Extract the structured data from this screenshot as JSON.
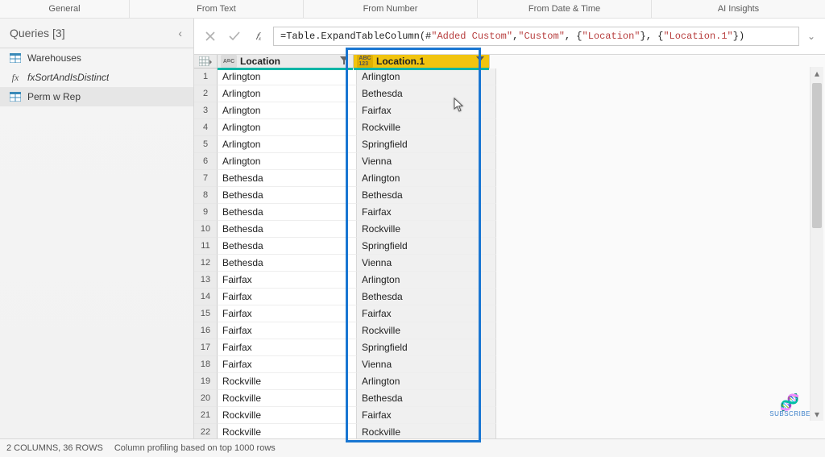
{
  "tabs": [
    "General",
    "From Text",
    "From Number",
    "From Date & Time",
    "AI Insights"
  ],
  "queries": {
    "title": "Queries",
    "count": "[3]",
    "items": [
      {
        "name": "Warehouses",
        "icon": "table"
      },
      {
        "name": "fxSortAndIsDistinct",
        "icon": "fx"
      },
      {
        "name": "Perm w Rep",
        "icon": "table",
        "selected": true
      }
    ]
  },
  "formula": {
    "prefix": "= ",
    "fn": "Table.ExpandTableColumn",
    "open": "(",
    "hash": "#",
    "arg1": "\"Added Custom\"",
    "c1": ", ",
    "arg2": "\"Custom\"",
    "c2": ", {",
    "arg3": "\"Location\"",
    "c3": "}, {",
    "arg4": "\"Location.1\"",
    "close": "})"
  },
  "columns": [
    {
      "name": "Location",
      "type": "ABC",
      "selected": false
    },
    {
      "name": "Location.1",
      "type": "ABC 123",
      "selected": true
    }
  ],
  "rows": [
    {
      "n": 1,
      "a": "Arlington",
      "b": "Arlington"
    },
    {
      "n": 2,
      "a": "Arlington",
      "b": "Bethesda"
    },
    {
      "n": 3,
      "a": "Arlington",
      "b": "Fairfax"
    },
    {
      "n": 4,
      "a": "Arlington",
      "b": "Rockville"
    },
    {
      "n": 5,
      "a": "Arlington",
      "b": "Springfield"
    },
    {
      "n": 6,
      "a": "Arlington",
      "b": "Vienna"
    },
    {
      "n": 7,
      "a": "Bethesda",
      "b": "Arlington"
    },
    {
      "n": 8,
      "a": "Bethesda",
      "b": "Bethesda"
    },
    {
      "n": 9,
      "a": "Bethesda",
      "b": "Fairfax"
    },
    {
      "n": 10,
      "a": "Bethesda",
      "b": "Rockville"
    },
    {
      "n": 11,
      "a": "Bethesda",
      "b": "Springfield"
    },
    {
      "n": 12,
      "a": "Bethesda",
      "b": "Vienna"
    },
    {
      "n": 13,
      "a": "Fairfax",
      "b": "Arlington"
    },
    {
      "n": 14,
      "a": "Fairfax",
      "b": "Bethesda"
    },
    {
      "n": 15,
      "a": "Fairfax",
      "b": "Fairfax"
    },
    {
      "n": 16,
      "a": "Fairfax",
      "b": "Rockville"
    },
    {
      "n": 17,
      "a": "Fairfax",
      "b": "Springfield"
    },
    {
      "n": 18,
      "a": "Fairfax",
      "b": "Vienna"
    },
    {
      "n": 19,
      "a": "Rockville",
      "b": "Arlington"
    },
    {
      "n": 20,
      "a": "Rockville",
      "b": "Bethesda"
    },
    {
      "n": 21,
      "a": "Rockville",
      "b": "Fairfax"
    },
    {
      "n": 22,
      "a": "Rockville",
      "b": "Rockville"
    }
  ],
  "status": {
    "summary": "2 COLUMNS, 36 ROWS",
    "profiling": "Column profiling based on top 1000 rows"
  },
  "subscribe": "SUBSCRIBE"
}
